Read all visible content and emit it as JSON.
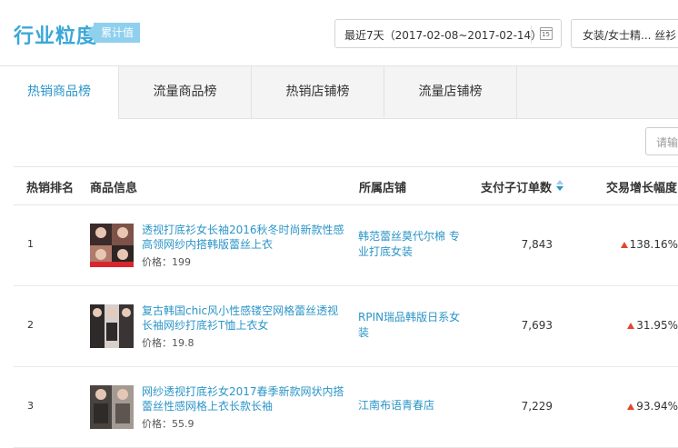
{
  "header": {
    "title": "行业粒度",
    "badge": "累计值",
    "date_range": "最近7天（2017-02-08~2017-02-14）",
    "calendar_day": "15",
    "category": "女装/女士精... 丝衫"
  },
  "tabs": [
    {
      "label": "热销商品榜",
      "active": true
    },
    {
      "label": "流量商品榜",
      "active": false
    },
    {
      "label": "热销店铺榜",
      "active": false
    },
    {
      "label": "流量店铺榜",
      "active": false
    }
  ],
  "search": {
    "placeholder": "请输入"
  },
  "table": {
    "headers": {
      "rank": "热销排名",
      "product": "商品信息",
      "shop": "所属店铺",
      "orders": "支付子订单数",
      "growth": "交易增长幅度"
    },
    "rows": [
      {
        "rank": "1",
        "name": "透视打底衫女长袖2016秋冬时尚新款性感高领网纱内搭韩版蕾丝上衣",
        "price_label": "价格：",
        "price": "199",
        "shop": "韩范蕾丝莫代尔棉 专业打底女装",
        "orders": "7,843",
        "growth": "138.16%"
      },
      {
        "rank": "2",
        "name": "复古韩国chic风小性感镂空网格蕾丝透视长袖网纱打底衫T恤上衣女",
        "price_label": "价格：",
        "price": "19.8",
        "shop": "RPIN瑞品韩版日系女装",
        "orders": "7,693",
        "growth": "31.95%"
      },
      {
        "rank": "3",
        "name": "网纱透视打底衫女2017春季新款网状内搭蕾丝性感网格上衣长款长袖",
        "price_label": "价格：",
        "price": "55.9",
        "shop": "江南布语青春店",
        "orders": "7,229",
        "growth": "93.94%"
      }
    ]
  },
  "colors": {
    "accent": "#2b95c8",
    "title": "#3aa8d8",
    "badge": "#8fd0ee",
    "growth_up": "#e4452c"
  }
}
